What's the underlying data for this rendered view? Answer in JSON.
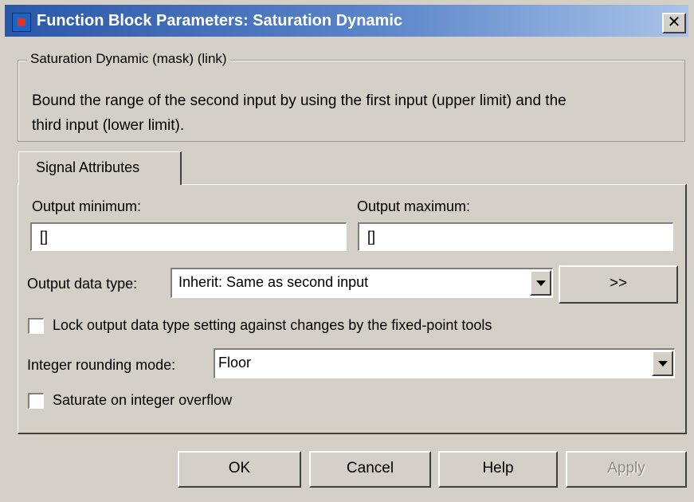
{
  "window": {
    "title": "Function Block Parameters: Saturation Dynamic",
    "close_glyph": "✕",
    "icon": "simulink-block-icon"
  },
  "description": {
    "legend": "Saturation Dynamic (mask) (link)",
    "text_line1": "Bound the range of the second input by using the first input (upper limit) and the",
    "text_line2": "third input (lower limit)."
  },
  "tabs": [
    {
      "label": "Signal Attributes",
      "selected": true
    }
  ],
  "fields": {
    "output_minimum": {
      "label": "Output minimum:",
      "value": "[]"
    },
    "output_maximum": {
      "label": "Output maximum:",
      "value": "[]"
    },
    "output_data_type": {
      "label": "Output data type:",
      "value": "Inherit: Same as second input",
      "assistant_button": ">>"
    },
    "lock_output": {
      "label": "Lock output data type setting against changes by the fixed-point tools",
      "checked": false
    },
    "rounding_mode": {
      "label": "Integer rounding mode:",
      "value": "Floor"
    },
    "saturate": {
      "label": "Saturate on integer overflow",
      "checked": false
    }
  },
  "buttons": {
    "ok": "OK",
    "cancel": "Cancel",
    "help": "Help",
    "apply": "Apply",
    "apply_enabled": false
  }
}
